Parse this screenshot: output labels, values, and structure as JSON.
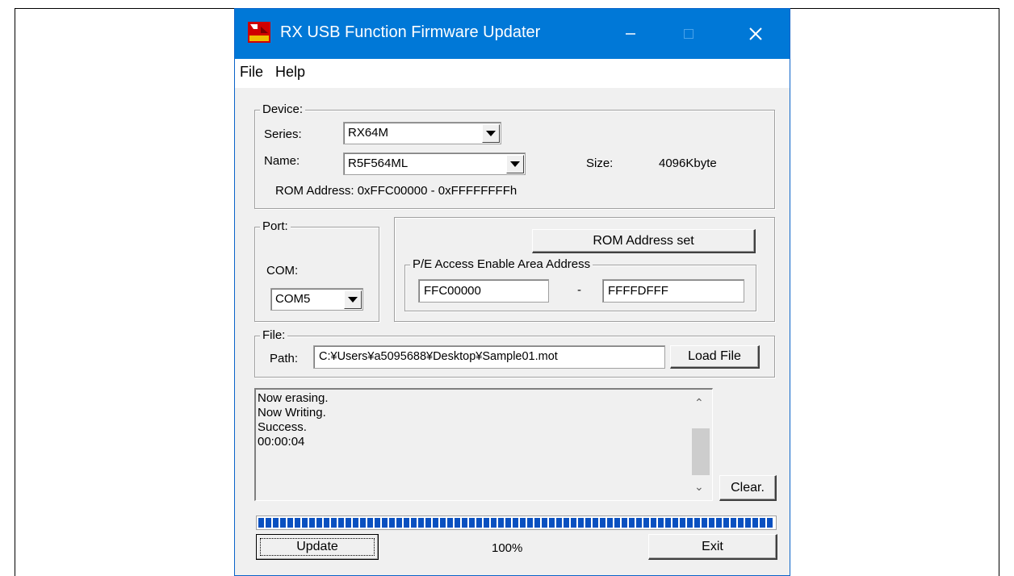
{
  "window": {
    "title": "RX USB Function Firmware Updater"
  },
  "menu": {
    "file": "File",
    "help": "Help"
  },
  "device": {
    "legend": "Device:",
    "series_label": "Series:",
    "series_value": "RX64M",
    "name_label": "Name:",
    "name_value": "R5F564ML",
    "size_label": "Size:",
    "size_value": "4096Kbyte",
    "rom_address": "ROM Address: 0xFFC00000 - 0xFFFFFFFFh"
  },
  "port": {
    "legend": "Port:",
    "com_label": "COM:",
    "com_value": "COM5"
  },
  "rom": {
    "set_button": "ROM Address set",
    "area_legend": "P/E Access Enable Area Address",
    "start": "FFC00000",
    "dash": "-",
    "end": "FFFFDFFF"
  },
  "file": {
    "legend": "File:",
    "path_label": "Path:",
    "path_value": "C:¥Users¥a5095688¥Desktop¥Sample01.mot",
    "load_button": "Load File"
  },
  "log": {
    "lines": [
      "Now erasing.",
      "Now Writing.",
      "Success.",
      "00:00:04"
    ],
    "clear_button": "Clear."
  },
  "progress": {
    "value": 1.0,
    "label": "100%"
  },
  "actions": {
    "update": "Update",
    "exit": "Exit"
  },
  "colors": {
    "titlebar": "#0078d7",
    "progress": "#0a50c0"
  }
}
